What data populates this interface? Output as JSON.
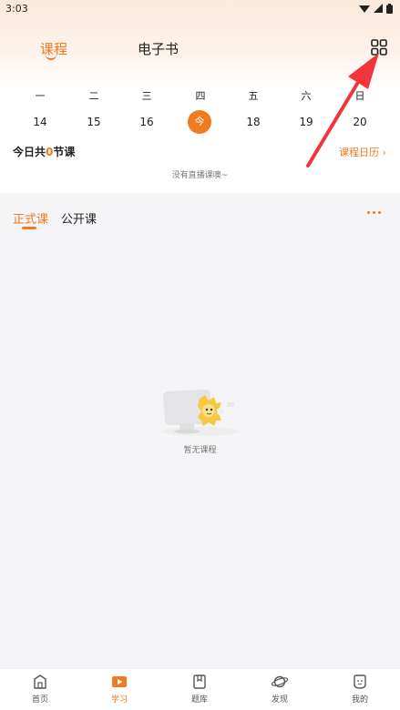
{
  "status_bar": {
    "time": "3:03"
  },
  "header": {
    "tabs": [
      {
        "label": "课程",
        "active": true
      },
      {
        "label": "电子书",
        "active": false
      }
    ]
  },
  "calendar": {
    "weekdays": [
      "一",
      "二",
      "三",
      "四",
      "五",
      "六",
      "日"
    ],
    "dates": [
      "14",
      "15",
      "16",
      "今",
      "18",
      "19",
      "20"
    ],
    "today_index": 3,
    "summary_prefix": "今日共",
    "summary_count": "0",
    "summary_suffix": "节课",
    "calendar_link": "课程日历 ›",
    "no_live_text": "没有直播课噢~"
  },
  "course_tabs": {
    "tabs": [
      {
        "label": "正式课",
        "active": true
      },
      {
        "label": "公开课",
        "active": false
      }
    ]
  },
  "empty_state": {
    "text": "暂无课程"
  },
  "bottom_nav": {
    "items": [
      {
        "label": "首页",
        "icon": "home-icon",
        "active": false
      },
      {
        "label": "学习",
        "icon": "play-icon",
        "active": true
      },
      {
        "label": "题库",
        "icon": "bookmark-icon",
        "active": false
      },
      {
        "label": "发现",
        "icon": "planet-icon",
        "active": false
      },
      {
        "label": "我的",
        "icon": "face-icon",
        "active": false
      }
    ]
  },
  "colors": {
    "accent": "#f07a1f",
    "arrow": "#f0353d",
    "background": "#f5f5f7"
  }
}
